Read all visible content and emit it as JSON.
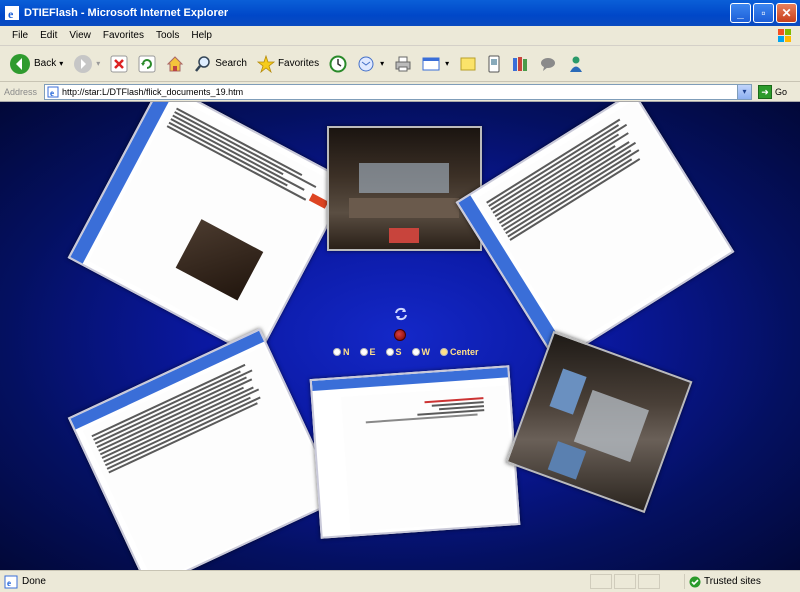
{
  "window": {
    "title": "DTIEFlash - Microsoft Internet Explorer"
  },
  "menu": [
    "File",
    "Edit",
    "View",
    "Favorites",
    "Tools",
    "Help"
  ],
  "toolbar": {
    "back": "Back",
    "search": "Search",
    "favorites": "Favorites"
  },
  "address": {
    "label": "Address",
    "url": "http://star:L/DTFlash/flick_documents_19.htm",
    "go": "Go"
  },
  "controls": {
    "north": "N",
    "east": "E",
    "south": "S",
    "west": "W",
    "center": "Center"
  },
  "status": {
    "text": "Done",
    "zone": "Trusted sites"
  },
  "colors": {
    "titlebar": "#0047c8",
    "background": "#0a18a0",
    "accent": "#ffe08a"
  }
}
